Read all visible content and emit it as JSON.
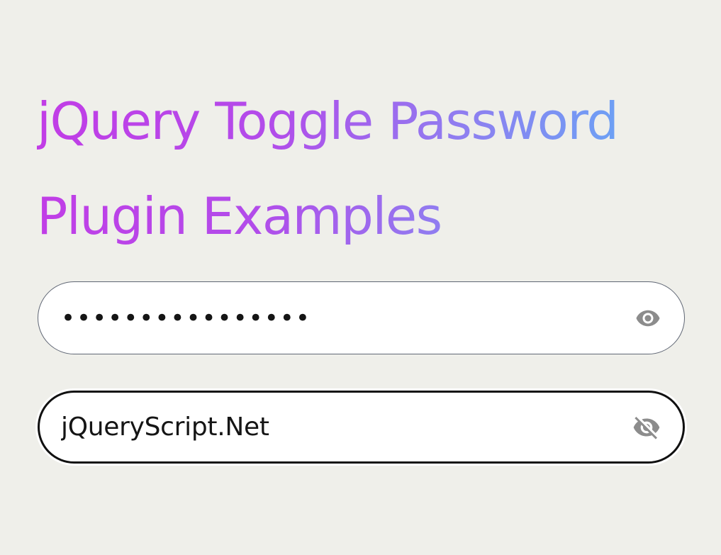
{
  "page": {
    "title_line1": "jQuery Toggle Password",
    "title_line2": "Plugin Examples"
  },
  "fields": [
    {
      "type": "password",
      "value": "jQueryScript.Net",
      "toggle_icon": "eye-icon"
    },
    {
      "type": "text",
      "value": "jQueryScript.Net",
      "toggle_icon": "eye-slash-icon"
    }
  ],
  "colors": {
    "background": "#efefea",
    "title_gradient_start": "#c23ce6",
    "title_gradient_end": "#55b8f8",
    "icon": "#8c8c8c"
  }
}
